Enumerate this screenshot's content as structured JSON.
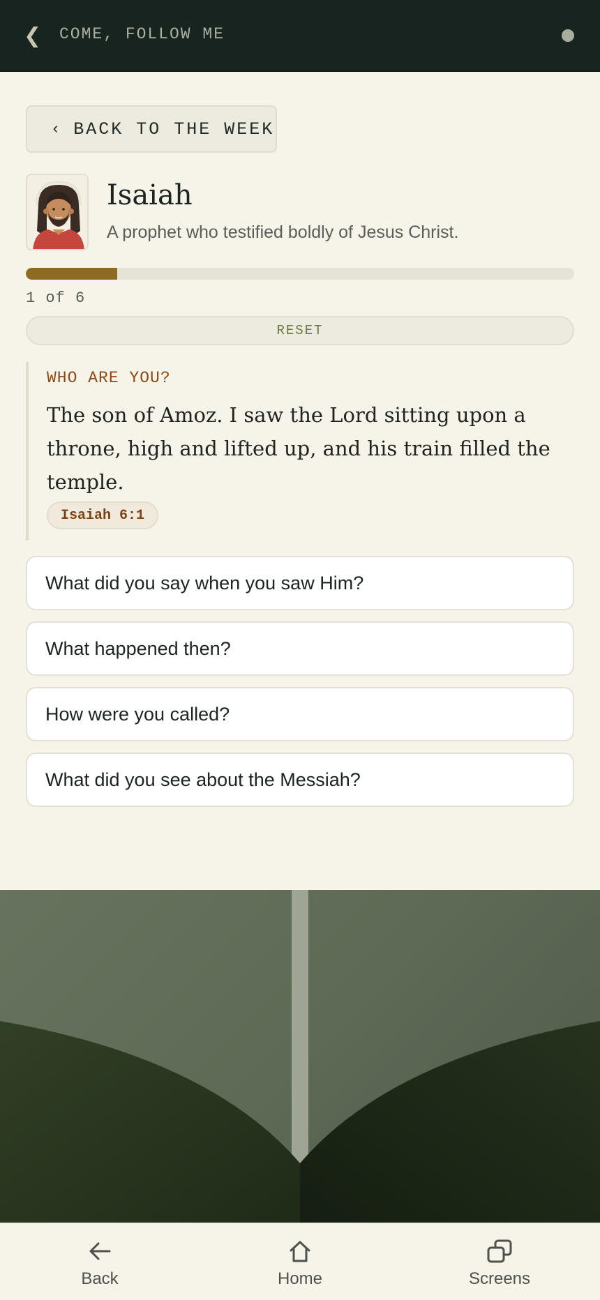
{
  "topbar": {
    "title": "COME, FOLLOW ME",
    "back_glyph": "❮"
  },
  "back_to_week": {
    "chevron": "‹",
    "label": "BACK TO THE WEEK"
  },
  "person": {
    "name": "Isaiah",
    "subtitle": "A prophet who testified boldly of Jesus Christ."
  },
  "progress": {
    "current": 1,
    "total": 6,
    "fraction": 0.1667,
    "text": "1 of 6"
  },
  "reset_label": "RESET",
  "quote": {
    "label": "WHO ARE YOU?",
    "text": "The son of Amoz. I saw the Lord sitting upon a throne, high and lifted up, and his train filled the temple.",
    "reference": "Isaiah 6:1"
  },
  "questions": [
    "What did you say when you saw Him?",
    "What happened then?",
    "How were you called?",
    "What did you see about the Messiah?"
  ],
  "bottom_nav": [
    {
      "label": "Back",
      "icon": "arrow-left-icon"
    },
    {
      "label": "Home",
      "icon": "home-icon"
    },
    {
      "label": "Screens",
      "icon": "screens-icon"
    }
  ],
  "colors": {
    "topbar": "#182420",
    "accent_progress": "#8d6b23",
    "quote_label": "#8a4a16",
    "reset_text": "#6c7a3e"
  }
}
